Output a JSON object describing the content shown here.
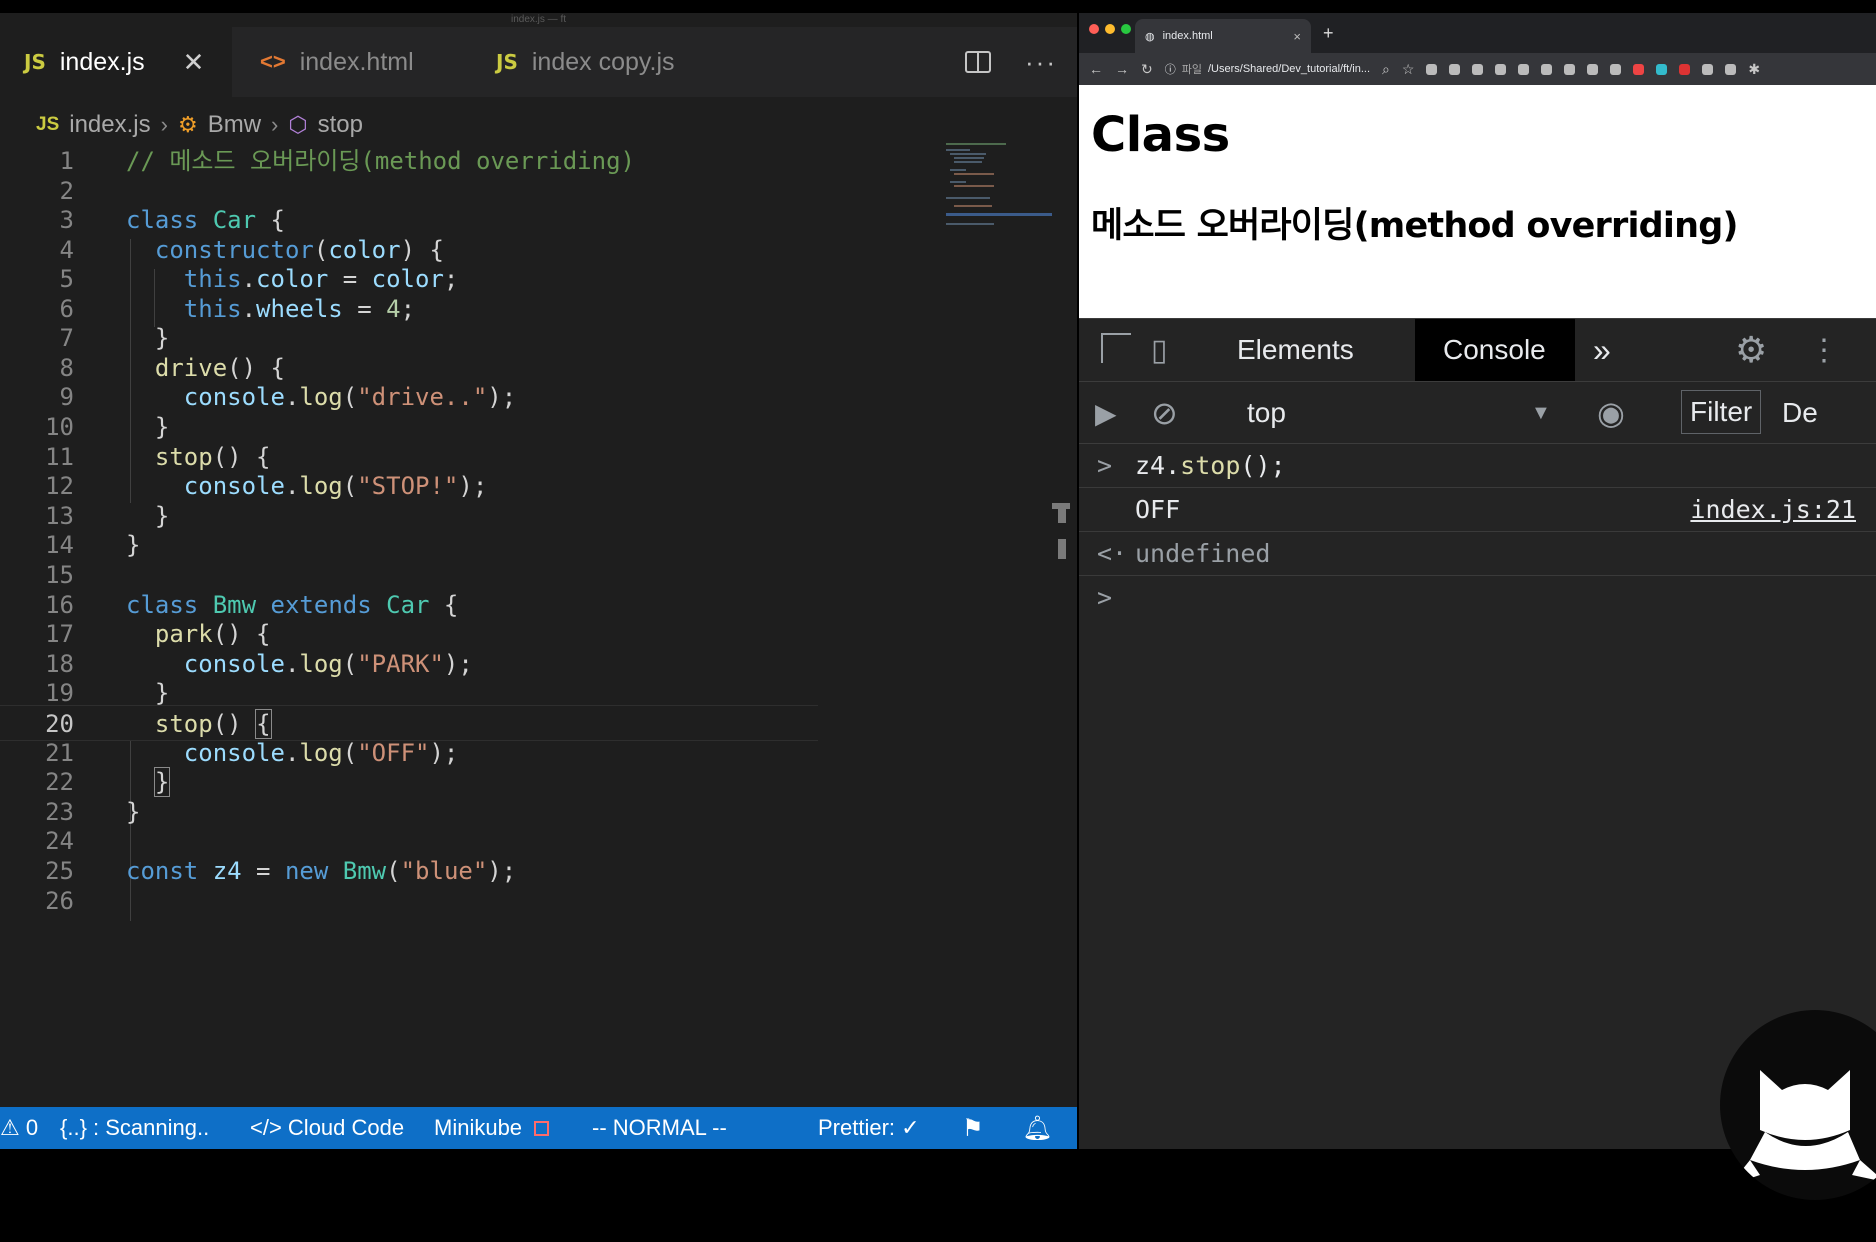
{
  "vscode": {
    "window_title": "index.js — ft",
    "tabs": [
      {
        "badge": "JS",
        "label": "index.js",
        "active": true
      },
      {
        "badge": "<>",
        "label": "index.html",
        "active": false
      },
      {
        "badge": "JS",
        "label": "index copy.js",
        "active": false
      }
    ],
    "close_glyph": "✕",
    "breadcrumb": {
      "file_badge": "JS",
      "file": "index.js",
      "class_name": "Bmw",
      "method": "stop"
    },
    "line_numbers": [
      "1",
      "2",
      "3",
      "4",
      "5",
      "6",
      "7",
      "8",
      "9",
      "10",
      "11",
      "12",
      "13",
      "14",
      "15",
      "16",
      "17",
      "18",
      "19",
      "20",
      "21",
      "22",
      "23",
      "24",
      "25",
      "26"
    ],
    "current_line": 20,
    "code": {
      "l1": "// 메소드 오버라이딩(method overriding)",
      "kw_class": "class",
      "kw_extends": "extends",
      "kw_this": "this",
      "kw_const": "const",
      "kw_new": "new",
      "car": "Car",
      "bmw": "Bmw",
      "constructor": "constructor",
      "color": "color",
      "wheels": "wheels",
      "num4": "4",
      "drive": "drive",
      "stop": "stop",
      "park": "park",
      "console": "console",
      "log": "log",
      "z4": "z4",
      "str_drive": "\"drive..\"",
      "str_stop": "\"STOP!\"",
      "str_park": "\"PARK\"",
      "str_off": "\"OFF\"",
      "str_blue": "\"blue\""
    },
    "status_bar": {
      "problems": "⚠ 0",
      "scanning": "{..} : Scanning..",
      "cloud_code": "</> Cloud Code",
      "minikube": "Minikube",
      "mode": "-- NORMAL --",
      "prettier": "Prettier: ✓"
    }
  },
  "browser": {
    "tab_title": "index.html",
    "address_label": "파일",
    "address": "/Users/Shared/Dev_tutorial/ft/in...",
    "page": {
      "h1": "Class",
      "h2": "메소드 오버라이딩(method overriding)"
    },
    "devtools": {
      "tabs": [
        "Elements",
        "Console"
      ],
      "more": "»",
      "context": "top",
      "filter_label": "Filter",
      "levels_label": "De",
      "console_lines": [
        {
          "prompt": ">",
          "obj": "z4",
          "dot": ".",
          "fn": "stop",
          "rest": "();"
        },
        {
          "output": "OFF",
          "source": "index.js:21"
        },
        {
          "prompt": "<·",
          "result": "undefined"
        }
      ],
      "input_prompt": ">"
    }
  },
  "colors": {
    "editor_bg": "#1e1e1e",
    "statusbar_bg": "#0e6fc7",
    "devtools_bg": "#242424",
    "keyword": "#569cd6",
    "type": "#4ec9b0",
    "function": "#dcdcaa",
    "variable": "#9cdcfe",
    "string": "#ce9178",
    "comment": "#6a9955"
  }
}
